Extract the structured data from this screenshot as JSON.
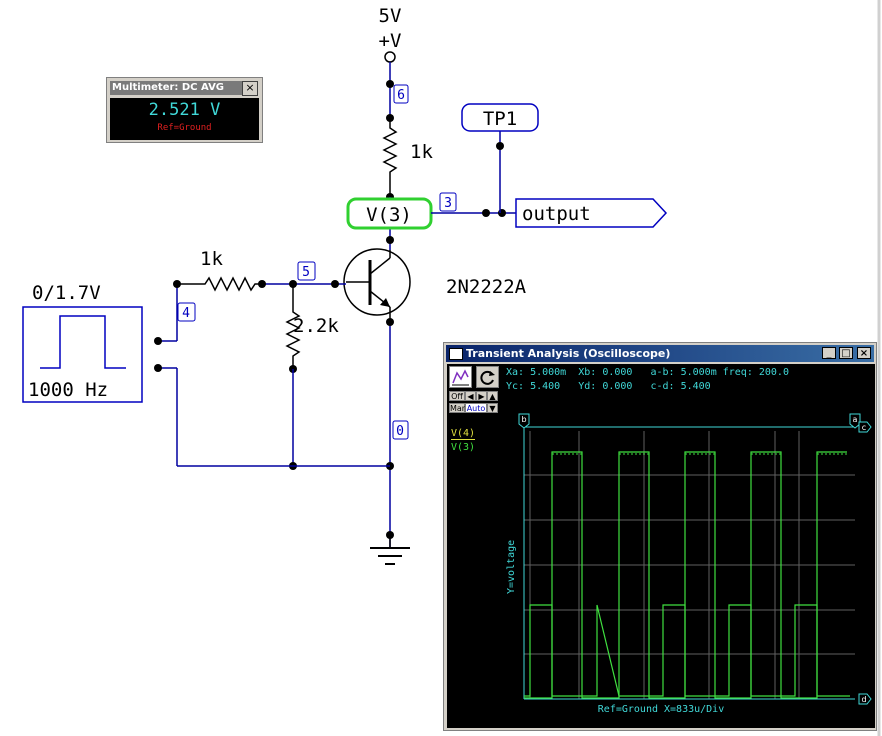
{
  "schematic": {
    "supply_voltage": "5V",
    "supply_symbol": "+V",
    "node_labels": [
      "6",
      "3",
      "5",
      "4",
      "0"
    ],
    "resistor_collector": "1k",
    "resistor_base": "1k",
    "resistor_bias": "2.2k",
    "transistor": "2N2222A",
    "probe_label": "V(3)",
    "testpoint": "TP1",
    "output_label": "output",
    "source_amplitude": "0/1.7V",
    "source_frequency": "1000 Hz"
  },
  "multimeter": {
    "title": "Multimeter: DC AVG",
    "close": "×",
    "value": "2.521 V",
    "ref": "Ref=Ground"
  },
  "oscilloscope": {
    "title": "Transient Analysis (Oscilloscope)",
    "readout_line1": "Xa: 5.000m  Xb: 0.000   a-b: 5.000m freq: 200.0",
    "readout_line2": "Yc: 5.400   Yd: 0.000   c-d: 5.400",
    "btn_off": "Off",
    "btn_man": "Man",
    "btn_auto": "Auto",
    "trace1": "V(4)",
    "trace2": "V(3)",
    "ylabel": "Y=voltage",
    "footer": "Ref=Ground  X=833u/Div",
    "cursor_a": "a",
    "cursor_b": "b",
    "cursor_c": "c",
    "cursor_d": "d",
    "trace_color": "#40e040",
    "text_color": "#40d8d8"
  },
  "colors": {
    "wire": "#0000a0",
    "node": "#000000",
    "probe": "#30d030"
  }
}
